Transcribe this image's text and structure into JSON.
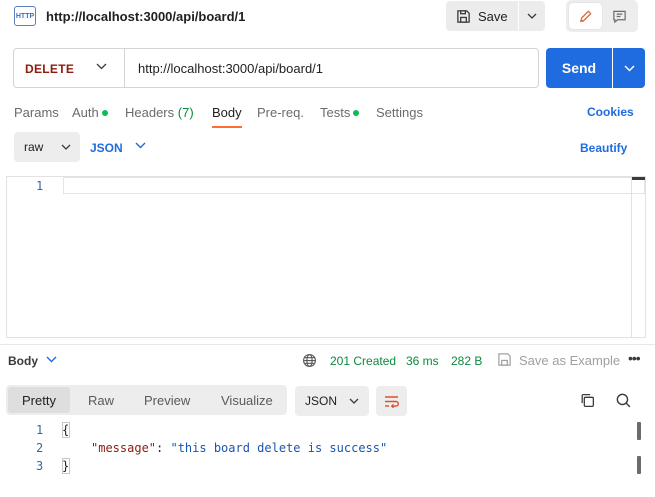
{
  "header": {
    "http_icon_text": "HTTP",
    "title": "http://localhost:3000/api/board/1",
    "save_label": "Save"
  },
  "request": {
    "method": "DELETE",
    "url": "http://localhost:3000/api/board/1",
    "send_label": "Send"
  },
  "tabs": {
    "params": "Params",
    "auth": "Auth",
    "headers": "Headers",
    "headers_count": "(7)",
    "body": "Body",
    "prereq": "Pre-req.",
    "tests": "Tests",
    "settings": "Settings",
    "cookies": "Cookies"
  },
  "body_toolbar": {
    "mode": "raw",
    "language": "JSON",
    "beautify": "Beautify"
  },
  "editor": {
    "line_numbers": [
      "1"
    ],
    "content": ""
  },
  "response": {
    "section_label": "Body",
    "status": "201 Created",
    "time": "36 ms",
    "size": "282 B",
    "save_example": "Save as Example",
    "tabs": [
      "Pretty",
      "Raw",
      "Preview",
      "Visualize"
    ],
    "active_tab": "Pretty",
    "format": "JSON",
    "line_numbers": [
      "1",
      "2",
      "3"
    ],
    "open_brace": "{",
    "close_brace": "}",
    "json_key": "\"message\"",
    "json_colon": ": ",
    "json_value": "\"this board delete is success\""
  },
  "colors": {
    "accent_blue": "#1e6ce0",
    "method_delete": "#8e1a10",
    "status_green": "#0a8a3c",
    "active_tab_underline": "#ff6c37"
  }
}
